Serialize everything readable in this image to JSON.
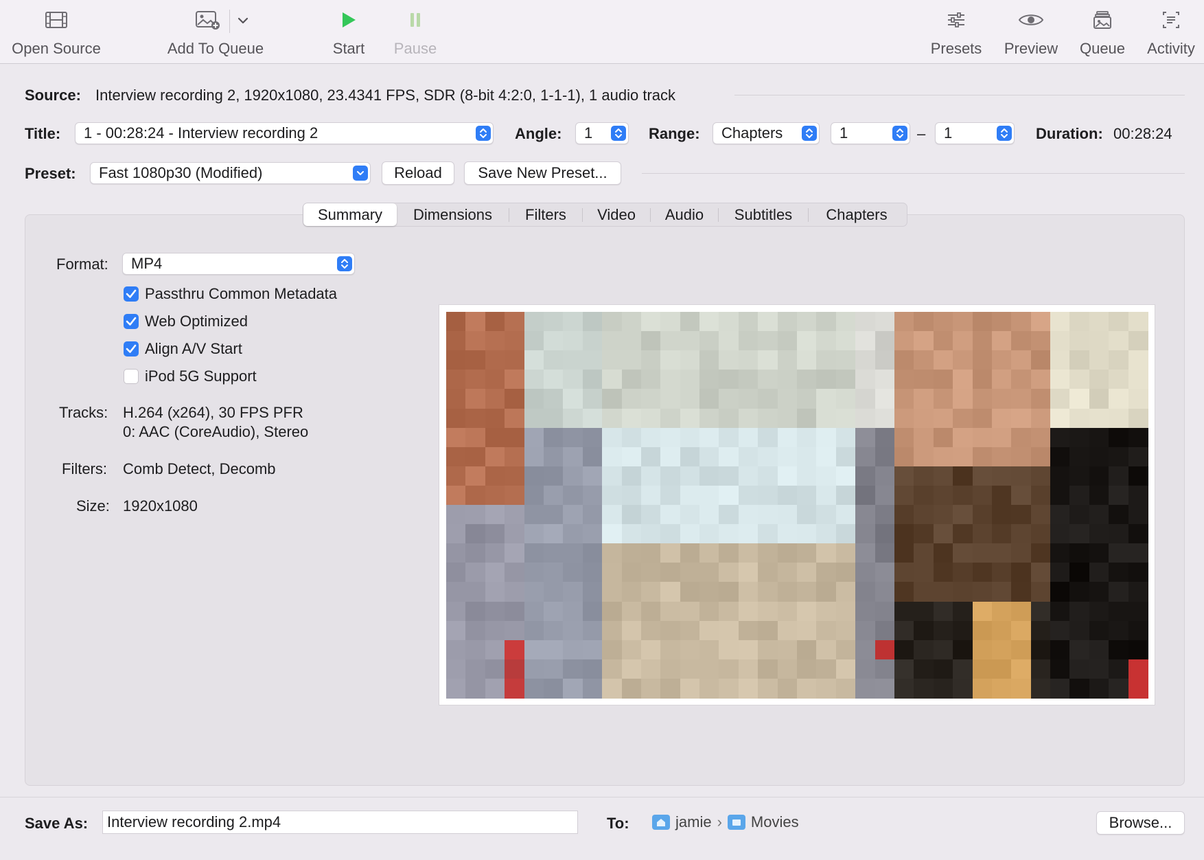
{
  "toolbar": {
    "open_source": "Open Source",
    "add_to_queue": "Add To Queue",
    "start": "Start",
    "pause": "Pause",
    "presets": "Presets",
    "preview": "Preview",
    "queue": "Queue",
    "activity": "Activity"
  },
  "source": {
    "label": "Source:",
    "value": "Interview recording 2, 1920x1080, 23.4341 FPS, SDR (8-bit 4:2:0, 1-1-1), 1 audio track"
  },
  "title_row": {
    "title_label": "Title:",
    "title_value": "1 - 00:28:24 - Interview recording 2",
    "angle_label": "Angle:",
    "angle_value": "1",
    "range_label": "Range:",
    "range_type": "Chapters",
    "range_start": "1",
    "range_dash": "–",
    "range_end": "1",
    "duration_label": "Duration:",
    "duration_value": "00:28:24"
  },
  "preset_row": {
    "label": "Preset:",
    "value": "Fast 1080p30 (Modified)",
    "reload": "Reload",
    "save_new": "Save New Preset..."
  },
  "tabs": [
    "Summary",
    "Dimensions",
    "Filters",
    "Video",
    "Audio",
    "Subtitles",
    "Chapters"
  ],
  "summary": {
    "format_label": "Format:",
    "format_value": "MP4",
    "checkboxes": [
      {
        "label": "Passthru Common Metadata",
        "checked": true
      },
      {
        "label": "Web Optimized",
        "checked": true
      },
      {
        "label": "Align A/V Start",
        "checked": true
      },
      {
        "label": "iPod 5G Support",
        "checked": false
      }
    ],
    "tracks_label": "Tracks:",
    "tracks_line1": "H.264 (x264), 30 FPS PFR",
    "tracks_line2": "0: AAC (CoreAudio), Stereo",
    "filters_label": "Filters:",
    "filters_value": "Comb Detect, Decomb",
    "size_label": "Size:",
    "size_value": "1920x1080"
  },
  "save": {
    "label": "Save As:",
    "filename": "Interview recording 2.mp4",
    "to_label": "To:",
    "path": [
      "jamie",
      "Movies"
    ],
    "path_sep": "›",
    "browse": "Browse..."
  },
  "colors": {
    "accent": "#2f7df6",
    "start_green": "#34c759",
    "pause_disabled": "#b9d9a8"
  },
  "icons": {
    "open_source": "film-icon",
    "add_to_queue": "photo-add-icon",
    "start": "play-icon",
    "pause": "pause-icon",
    "presets": "sliders-icon",
    "preview": "eye-icon",
    "queue": "stack-icon",
    "activity": "log-icon"
  }
}
